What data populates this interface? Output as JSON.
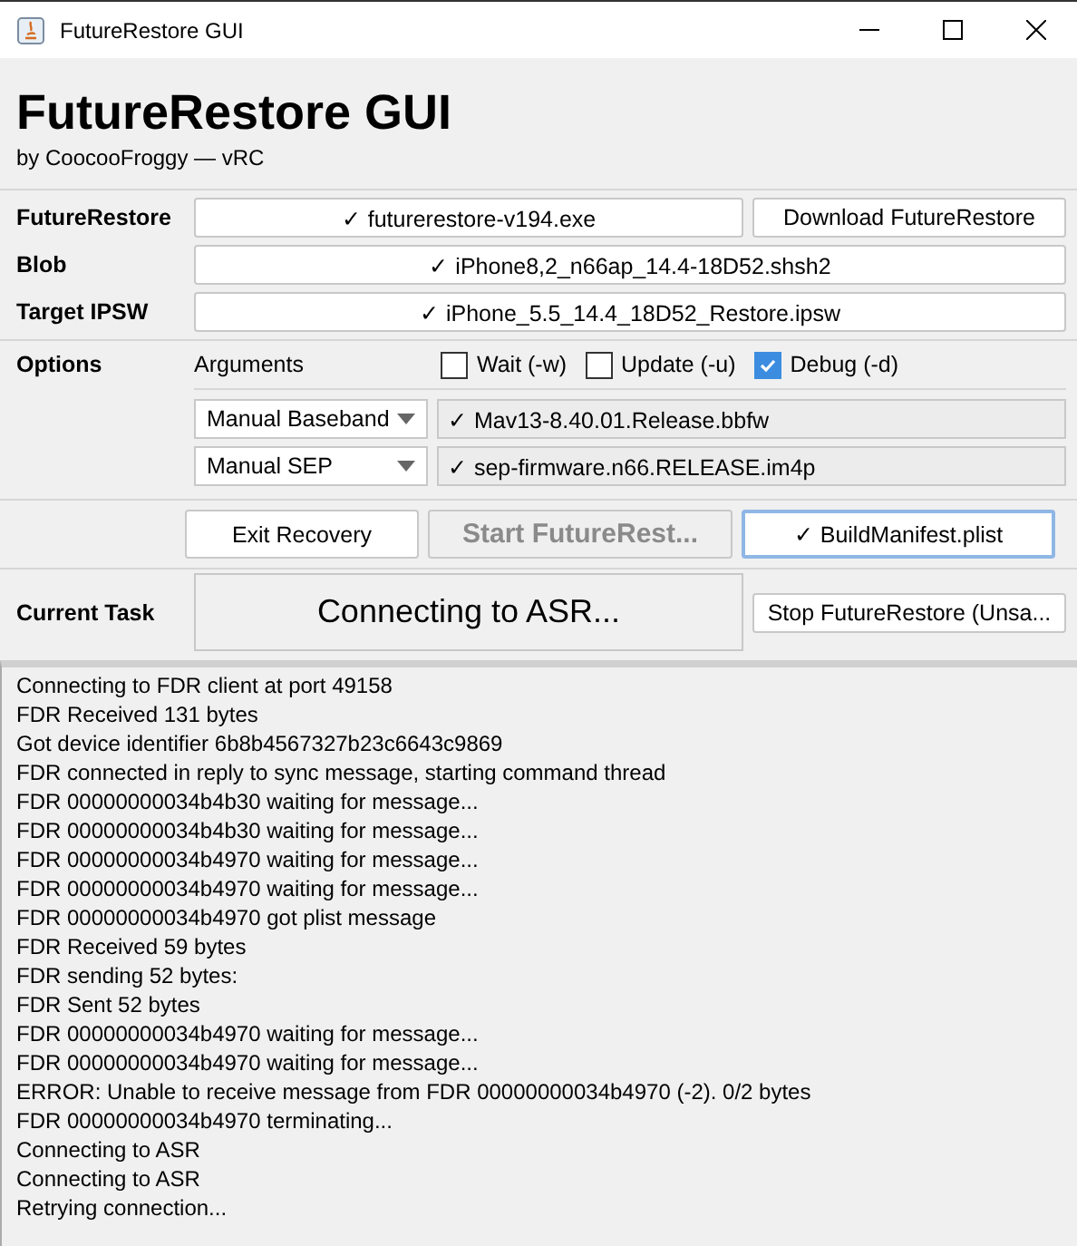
{
  "window": {
    "title": "FutureRestore GUI"
  },
  "header": {
    "title": "FutureRestore GUI",
    "subtitle": "by CoocooFroggy — vRC"
  },
  "file_rows": [
    {
      "label": "FutureRestore",
      "value": "✓ futurerestore-v194.exe",
      "button": "Download FutureRestore"
    },
    {
      "label": "Blob",
      "value": "✓ iPhone8,2_n66ap_14.4-18D52.shsh2"
    },
    {
      "label": "Target IPSW",
      "value": "✓ iPhone_5.5_14.4_18D52_Restore.ipsw"
    }
  ],
  "options": {
    "label": "Options",
    "arguments_label": "Arguments",
    "checkboxes": [
      {
        "label": "Wait (-w)",
        "checked": false
      },
      {
        "label": "Update (-u)",
        "checked": false
      },
      {
        "label": "Debug (-d)",
        "checked": true
      }
    ],
    "selectors": [
      {
        "value": "Manual Baseband",
        "file": "✓ Mav13-8.40.01.Release.bbfw"
      },
      {
        "value": "Manual SEP",
        "file": "✓ sep-firmware.n66.RELEASE.im4p"
      }
    ]
  },
  "actions": [
    {
      "label": "Exit Recovery",
      "disabled": false,
      "focused": false
    },
    {
      "label": "Start FutureRest...",
      "disabled": true,
      "focused": false
    },
    {
      "label": "✓ BuildManifest.plist",
      "disabled": false,
      "focused": true
    }
  ],
  "current_task": {
    "label": "Current Task",
    "status": "Connecting to ASR...",
    "button": "Stop FutureRestore (Unsa..."
  },
  "log": [
    "Connecting to FDR client at port 49158",
    "FDR Received 131 bytes",
    "Got device identifier 6b8b4567327b23c6643c9869",
    "FDR connected in reply to sync message, starting command thread",
    "FDR 00000000034b4b30 waiting for message...",
    "FDR 00000000034b4b30 waiting for message...",
    "FDR 00000000034b4970 waiting for message...",
    "FDR 00000000034b4970 waiting for message...",
    "FDR 00000000034b4970 got plist message",
    "FDR Received 59 bytes",
    "FDR sending 52 bytes:",
    "FDR Sent 52 bytes",
    "FDR 00000000034b4970 waiting for message...",
    "FDR 00000000034b4970 waiting for message...",
    "ERROR: Unable to receive message from FDR 00000000034b4970 (-2). 0/2 bytes",
    "FDR 00000000034b4970 terminating...",
    "Connecting to ASR",
    "Connecting to ASR",
    "Retrying connection..."
  ]
}
